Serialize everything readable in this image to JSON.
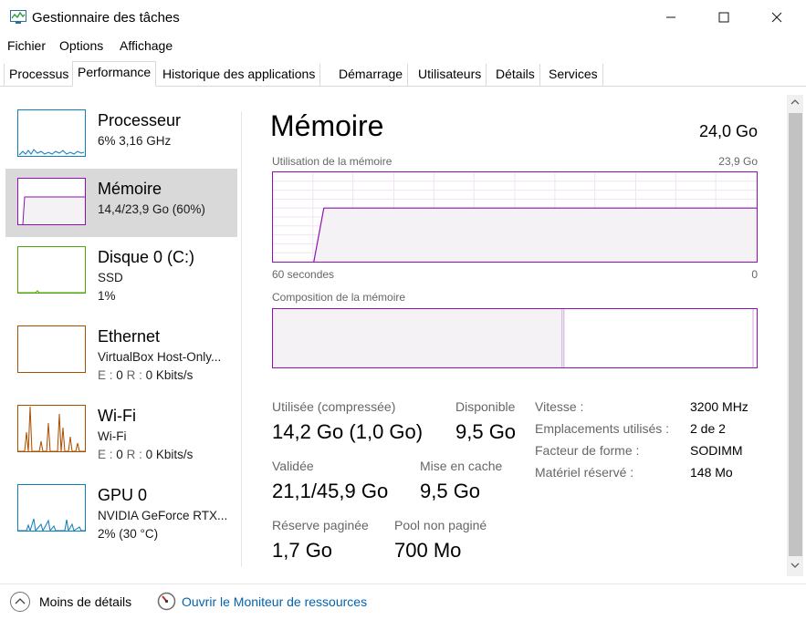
{
  "window": {
    "title": "Gestionnaire des tâches"
  },
  "menu": [
    "Fichier",
    "Options",
    "Affichage"
  ],
  "tabs": [
    "Processus",
    "Performance",
    "Historique des applications",
    "Démarrage",
    "Utilisateurs",
    "Détails",
    "Services"
  ],
  "sidebar": [
    {
      "name": "Processeur",
      "line1": "6%  3,16 GHz",
      "line2": "",
      "color": "#117dbb"
    },
    {
      "name": "Mémoire",
      "line1": "14,4/23,9 Go (60%)",
      "line2": "",
      "color": "#8b12ae"
    },
    {
      "name": "Disque 0 (C:)",
      "line1": "SSD",
      "line2": "1%",
      "color": "#4da60c"
    },
    {
      "name": "Ethernet",
      "line1": "VirtualBox Host-Only...",
      "line2_e": "E :",
      "line2_ev": "0",
      "line2_r": "R :",
      "line2_rv": "0 Kbits/s",
      "color": "#a74f01"
    },
    {
      "name": "Wi-Fi",
      "line1": "Wi-Fi",
      "line2_e": "E :",
      "line2_ev": "0",
      "line2_r": "R :",
      "line2_rv": "0 Kbits/s",
      "color": "#a74f01"
    },
    {
      "name": "GPU 0",
      "line1": "NVIDIA GeForce RTX...",
      "line2": "2%  (30 °C)",
      "color": "#117dbb"
    }
  ],
  "main": {
    "title": "Mémoire",
    "total": "24,0 Go",
    "usage_label": "Utilisation de la mémoire",
    "usage_max": "23,9 Go",
    "time_left": "60 secondes",
    "time_right": "0",
    "composition_label": "Composition de la mémoire",
    "usage_fraction": 0.6
  },
  "stats": {
    "used_label": "Utilisée (compressée)",
    "used_value": "14,2 Go (1,0 Go)",
    "available_label": "Disponible",
    "available_value": "9,5 Go",
    "committed_label": "Validée",
    "committed_value": "21,1/45,9 Go",
    "cached_label": "Mise en cache",
    "cached_value": "9,5 Go",
    "paged_label": "Réserve paginée",
    "paged_value": "1,7 Go",
    "nonpaged_label": "Pool non paginé",
    "nonpaged_value": "700 Mo"
  },
  "specs": [
    {
      "label": "Vitesse :",
      "value": "3200 MHz"
    },
    {
      "label": "Emplacements utilisés :",
      "value": "2 de 2"
    },
    {
      "label": "Facteur de forme :",
      "value": "SODIMM"
    },
    {
      "label": "Matériel réservé :",
      "value": "148 Mo"
    }
  ],
  "footer": {
    "less_details": "Moins de détails",
    "resource_monitor": "Ouvrir le Moniteur de ressources"
  },
  "colors": {
    "memory": "#8b12ae",
    "cpu": "#117dbb",
    "disk": "#4da60c",
    "network": "#a74f01",
    "link": "#0063b1"
  }
}
